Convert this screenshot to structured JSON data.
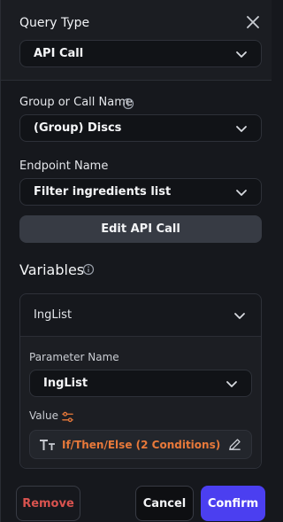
{
  "query_type": {
    "title": "Query Type",
    "selected": "API Call"
  },
  "group": {
    "label": "Group or Call Name",
    "selected": "(Group) Discs"
  },
  "endpoint": {
    "label": "Endpoint Name",
    "selected": "Filter ingredients list"
  },
  "edit_button_label": "Edit API Call",
  "variables": {
    "title": "Variables",
    "item": {
      "name": "IngList",
      "parameter_label": "Parameter Name",
      "parameter_selected": "IngList",
      "value_label": "Value",
      "value_text": "If/Then/Else (2 Conditions)"
    }
  },
  "footer": {
    "remove_label": "Remove",
    "cancel_label": "Cancel",
    "confirm_label": "Confirm"
  },
  "colors": {
    "accent": "#4b3ff0",
    "danger": "#d9534f",
    "value_orange": "#e8793a"
  },
  "icons": [
    "close-icon",
    "chevron-down-icon",
    "info-icon",
    "sliders-icon",
    "text-type-icon",
    "pencil-icon"
  ]
}
